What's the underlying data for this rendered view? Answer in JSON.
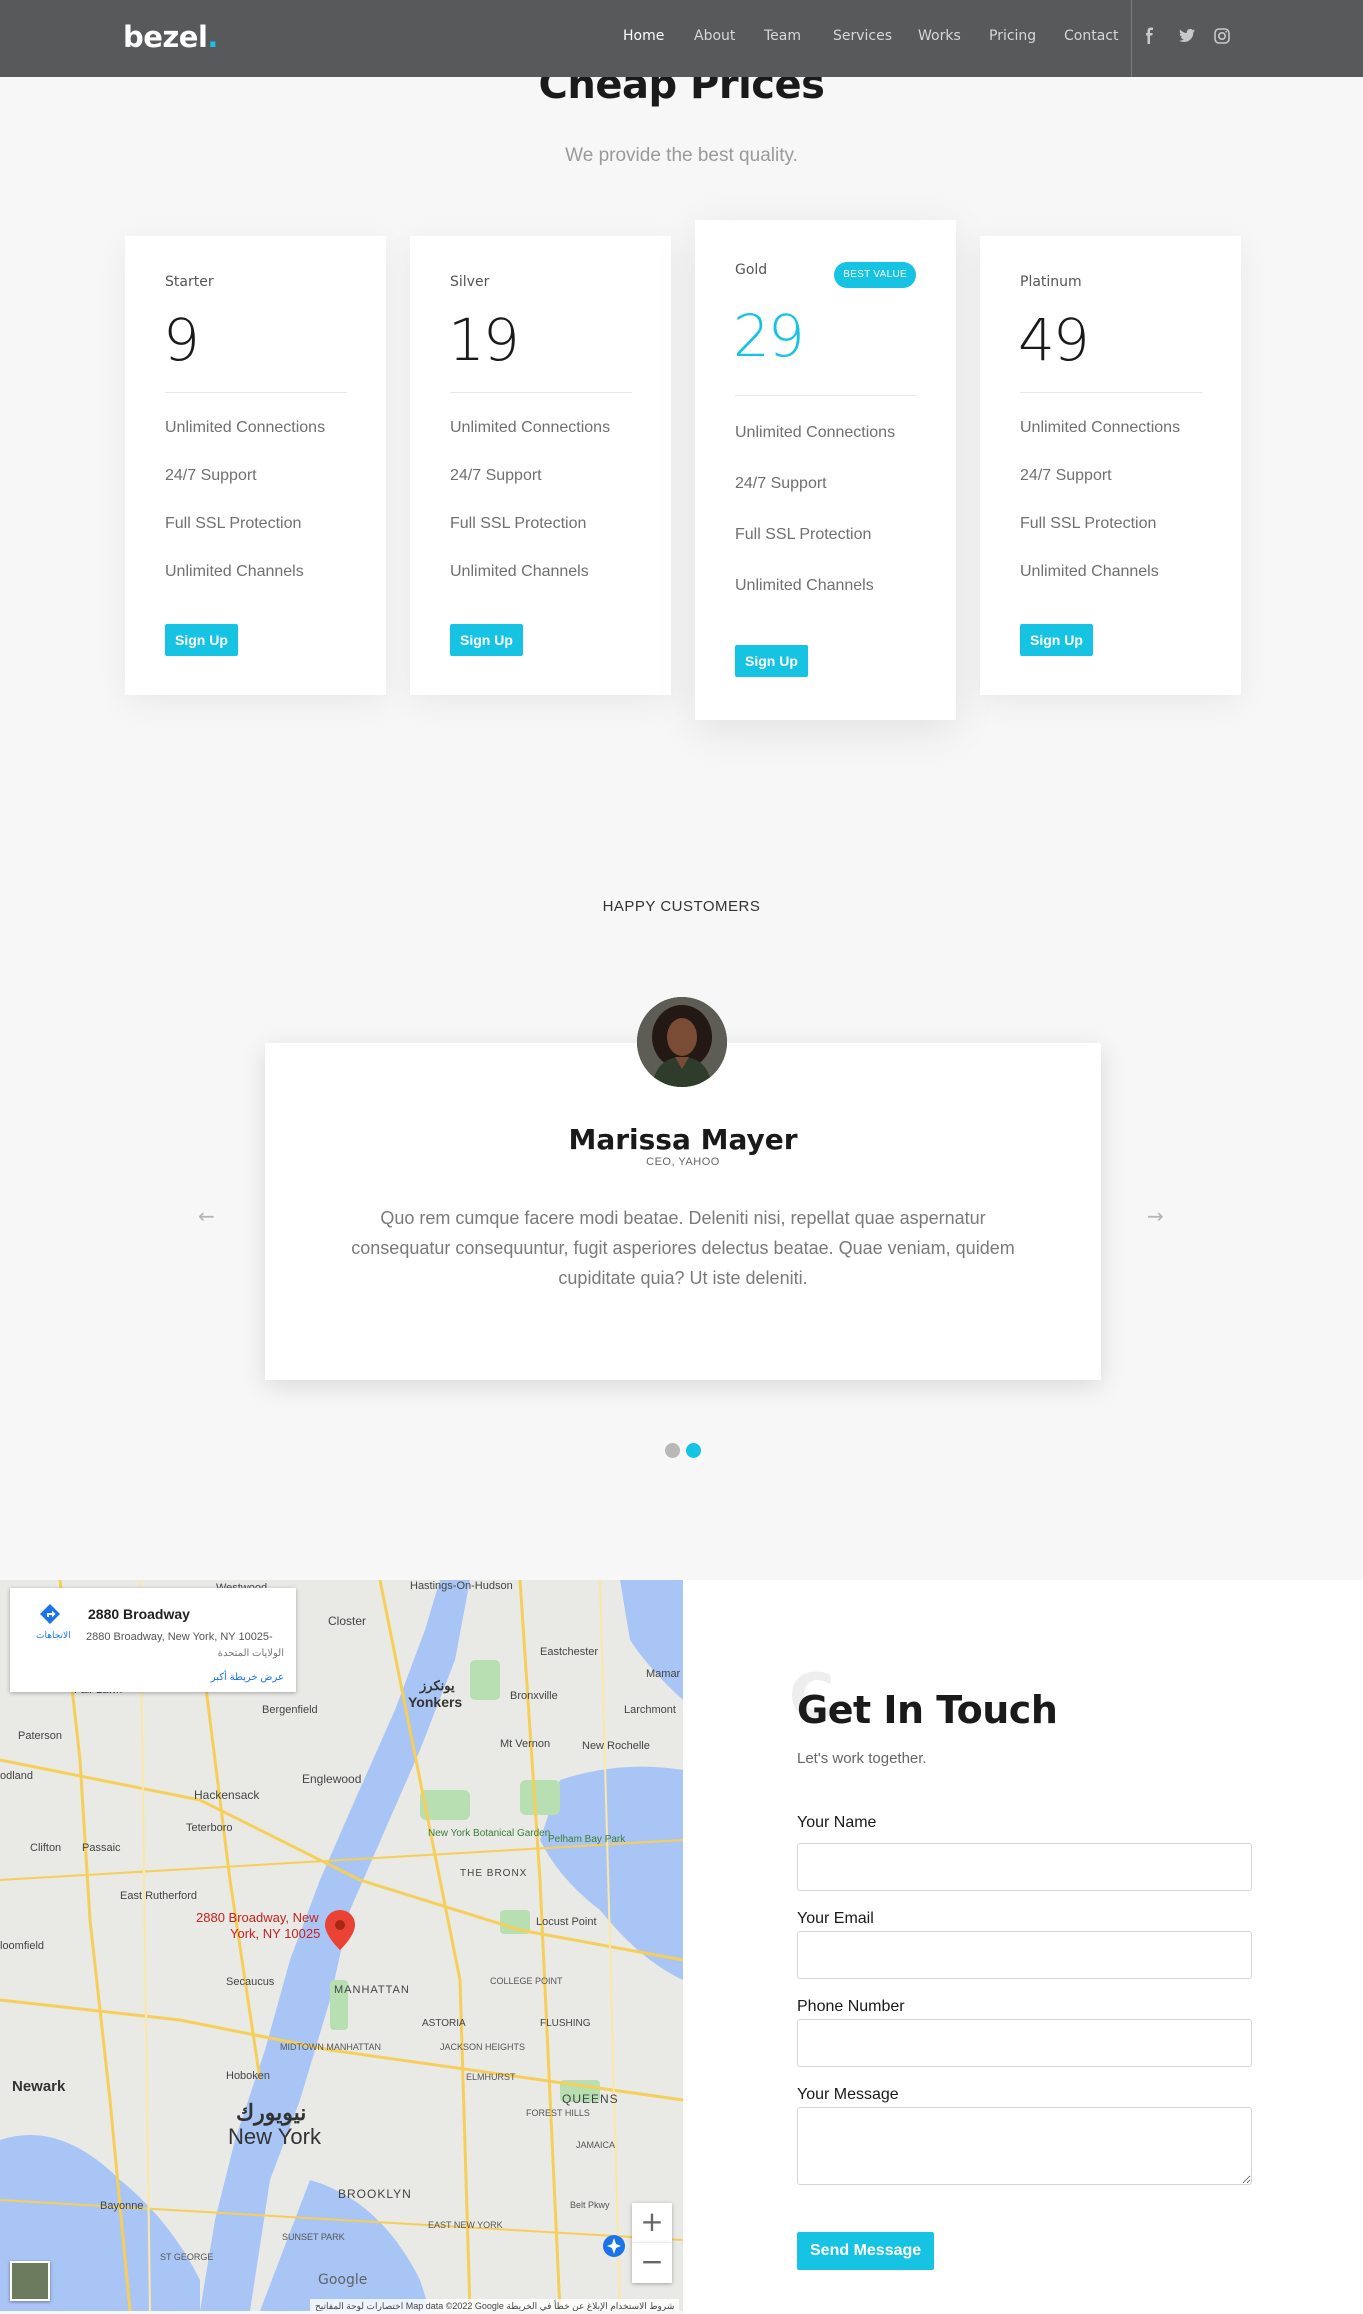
{
  "nav": {
    "logo": "bezel",
    "logo_dot": ".",
    "links": [
      "Home",
      "About",
      "Team",
      "Services",
      "Works",
      "Pricing",
      "Contact"
    ],
    "social": [
      "facebook-icon",
      "twitter-icon",
      "instagram-icon"
    ]
  },
  "pricing": {
    "title": "Cheap Prices",
    "subtitle": "We provide the best quality.",
    "plans": [
      {
        "name": "Starter",
        "price": "9",
        "features": [
          "Unlimited Connections",
          "24/7 Support",
          "Full SSL Protection",
          "Unlimited Channels"
        ],
        "button": "Sign Up"
      },
      {
        "name": "Silver",
        "price": "19",
        "features": [
          "Unlimited Connections",
          "24/7 Support",
          "Full SSL Protection",
          "Unlimited Channels"
        ],
        "button": "Sign Up"
      },
      {
        "name": "Gold",
        "price": "29",
        "badge": "BEST VALUE",
        "features": [
          "Unlimited Connections",
          "24/7 Support",
          "Full SSL Protection",
          "Unlimited Channels"
        ],
        "button": "Sign Up"
      },
      {
        "name": "Platinum",
        "price": "49",
        "features": [
          "Unlimited Connections",
          "24/7 Support",
          "Full SSL Protection",
          "Unlimited Channels"
        ],
        "button": "Sign Up"
      }
    ]
  },
  "testimonials": {
    "heading": "HAPPY CUSTOMERS",
    "name": "Marissa Mayer",
    "role": "CEO, YAHOO",
    "quote": "Quo rem cumque facere modi beatae. Deleniti nisi, repellat quae aspernatur consequatur consequuntur, fugit asperiores delectus beatae. Quae veniam, quidem cupiditate quia? Ut iste deleniti.",
    "prev": "←",
    "next": "→",
    "active_slide": 2,
    "slide_count": 2
  },
  "map": {
    "place_title": "2880 Broadway",
    "place_address": "2880 Broadway, New York, NY 10025-",
    "place_country": "الولايات المتحدة",
    "directions": "الاتجاهات",
    "larger_map": "عرض خريطة أكبر",
    "pin_label_1": "2880 Broadway, New",
    "pin_label_2": "York, NY 10025",
    "google": "Google",
    "footer": "اختصارات لوحة المفاتيح   Map data ©2022 Google   شروط الاستخدام   الإبلاغ عن خطأ في الخريطة",
    "zoom_in": "+",
    "zoom_out": "−",
    "labels": {
      "westwood": "Westwood",
      "hastings": "Hastings-On-Hudson",
      "closter": "Closter",
      "yonkers_ar": "يونكرز",
      "yonkers": "Yonkers",
      "bergenfield": "Bergenfield",
      "paterson": "Paterson",
      "hackensack": "Hackensack",
      "englewood": "Englewood",
      "teterboro": "Teterboro",
      "passaic": "Passaic",
      "clifton": "Clifton",
      "rutherford": "East Rutherford",
      "secaucus": "Secaucus",
      "manhattan": "MANHATTAN",
      "midtown": "MIDTOWN MANHATTAN",
      "hoboken": "Hoboken",
      "newark": "Newark",
      "newyork_ar": "نيويورك",
      "newyork": "New York",
      "bayonne": "Bayonne",
      "brooklyn": "BROOKLYN",
      "queens": "QUEENS",
      "bronx": "THE BRONX",
      "astoria": "ASTORIA",
      "flushing": "FLUSHING",
      "jackson": "JACKSON HEIGHTS",
      "elmhurst": "ELMHURST",
      "forest": "FOREST HILLS",
      "jamaica": "JAMAICA",
      "college": "COLLEGE POINT",
      "locust": "Locust Point",
      "mtvernon": "Mt Vernon",
      "newrochelle": "New Rochelle",
      "eastchester": "Eastchester",
      "bronxville": "Bronxville",
      "larchmont": "Larchmont",
      "pelham": "Pelham Bay Park",
      "botanical": "New York Botanical Garden",
      "eastny": "EAST NEW YORK",
      "sunset": "SUNSET PARK",
      "stgeorge": "ST GEORGE",
      "beltpkwy": "Belt Pkwy",
      "fairlawn": "Fair Lawn",
      "odland": "odland",
      "mamar": "Mamar",
      "loomfield": "loomfield"
    }
  },
  "contact": {
    "ghost": "C",
    "title": "Get In Touch",
    "subtitle": "Let's work together.",
    "fields": [
      {
        "label": "Your Name"
      },
      {
        "label": "Your Email"
      },
      {
        "label": "Phone Number"
      },
      {
        "label": "Your Message"
      }
    ],
    "submit": "Send Message"
  },
  "colors": {
    "accent": "#17c3e3",
    "nav_bg": "#58595b",
    "page_bg": "#f7f7f7"
  }
}
